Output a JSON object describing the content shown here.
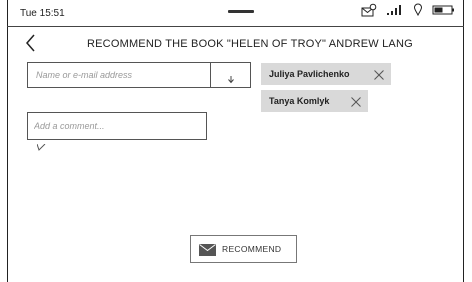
{
  "status_bar": {
    "time": "Tue 15:51",
    "icons": [
      "chat-wifi-icon",
      "signal-icon",
      "location-icon",
      "battery-icon"
    ]
  },
  "header": {
    "title": "RECOMMEND THE BOOK \"HELEN OF TROY\" ANDREW LANG",
    "back_icon": "chevron-left-icon"
  },
  "recipient": {
    "placeholder": "Name or e-mail address",
    "value": "",
    "dropdown_icon": "arrow-down-icon"
  },
  "recipients_selected": [
    {
      "name": "Juliya Pavlichenko"
    },
    {
      "name": "Tanya Komlyk"
    }
  ],
  "comment": {
    "placeholder": "Add a comment...",
    "value": ""
  },
  "actions": {
    "recommend_label": "RECOMMEND",
    "recommend_icon": "envelope-icon"
  },
  "colors": {
    "chip_background": "#d9d9d9",
    "border": "#555555",
    "text": "#222222"
  }
}
